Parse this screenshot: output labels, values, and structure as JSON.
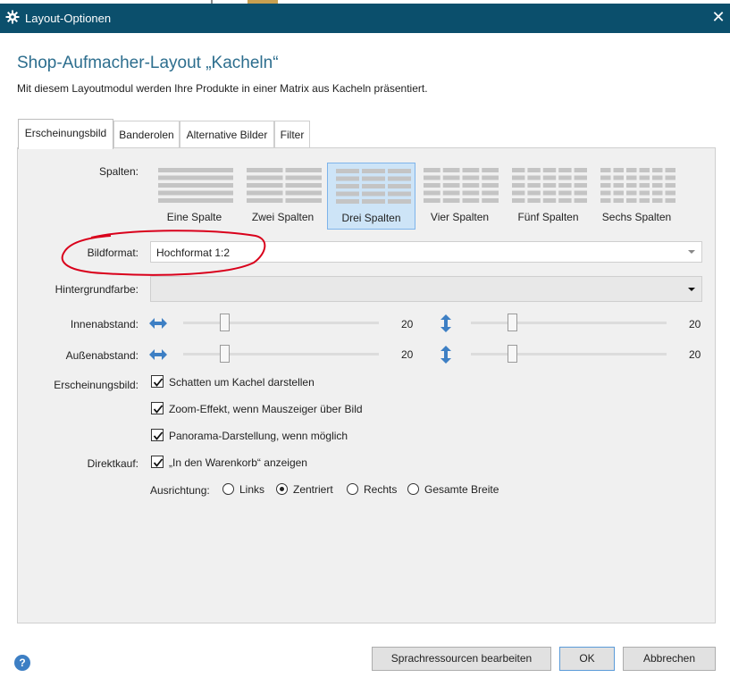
{
  "window": {
    "title": "Layout-Optionen",
    "close_glyph": "✕",
    "title_icon": "gear-icon"
  },
  "header": {
    "title": "Shop-Aufmacher-Layout „Kacheln“",
    "subtitle": "Mit diesem Layoutmodul werden Ihre Produkte in einer Matrix aus Kacheln präsentiert."
  },
  "tabs": [
    {
      "label": "Erscheinungsbild",
      "active": true
    },
    {
      "label": "Banderolen",
      "active": false
    },
    {
      "label": "Alternative Bilder",
      "active": false
    },
    {
      "label": "Filter",
      "active": false
    }
  ],
  "form": {
    "columns_label": "Spalten:",
    "columns": [
      {
        "label": "Eine Spalte",
        "count": 1,
        "selected": false
      },
      {
        "label": "Zwei Spalten",
        "count": 2,
        "selected": false
      },
      {
        "label": "Drei Spalten",
        "count": 3,
        "selected": true
      },
      {
        "label": "Vier Spalten",
        "count": 4,
        "selected": false
      },
      {
        "label": "Fünf Spalten",
        "count": 5,
        "selected": false
      },
      {
        "label": "Sechs Spalten",
        "count": 6,
        "selected": false
      }
    ],
    "image_format_label": "Bildformat:",
    "image_format_value": "Hochformat 1:2",
    "background_label": "Hintergrundfarbe:",
    "background_value": "",
    "inner_padding_label": "Innenabstand:",
    "inner_padding_h": 20,
    "inner_padding_v": 20,
    "outer_padding_label": "Außenabstand:",
    "outer_padding_h": 20,
    "outer_padding_v": 20,
    "appearance_label": "Erscheinungsbild:",
    "appearance_options": [
      {
        "label": "Schatten um Kachel darstellen",
        "checked": true
      },
      {
        "label": "Zoom-Effekt, wenn Mauszeiger über Bild",
        "checked": true
      },
      {
        "label": "Panorama-Darstellung, wenn möglich",
        "checked": true
      }
    ],
    "direct_buy_label": "Direktkauf:",
    "direct_buy_option": {
      "label": "„In den Warenkorb“ anzeigen",
      "checked": true
    },
    "alignment_label": "Ausrichtung:",
    "alignment_options": [
      {
        "label": "Links",
        "selected": false
      },
      {
        "label": "Zentriert",
        "selected": true
      },
      {
        "label": "Rechts",
        "selected": false
      },
      {
        "label": "Gesamte Breite",
        "selected": false
      }
    ]
  },
  "footer": {
    "help_glyph": "?",
    "edit_resources_label": "Sprachressourcen bearbeiten",
    "ok_label": "OK",
    "cancel_label": "Abbrechen"
  },
  "colors": {
    "titlebar": "#0b4f6c",
    "heading": "#2d6e8e",
    "selection": "#cde4f7",
    "annotation": "#d9001b",
    "icon_blue": "#3d7fc4"
  }
}
